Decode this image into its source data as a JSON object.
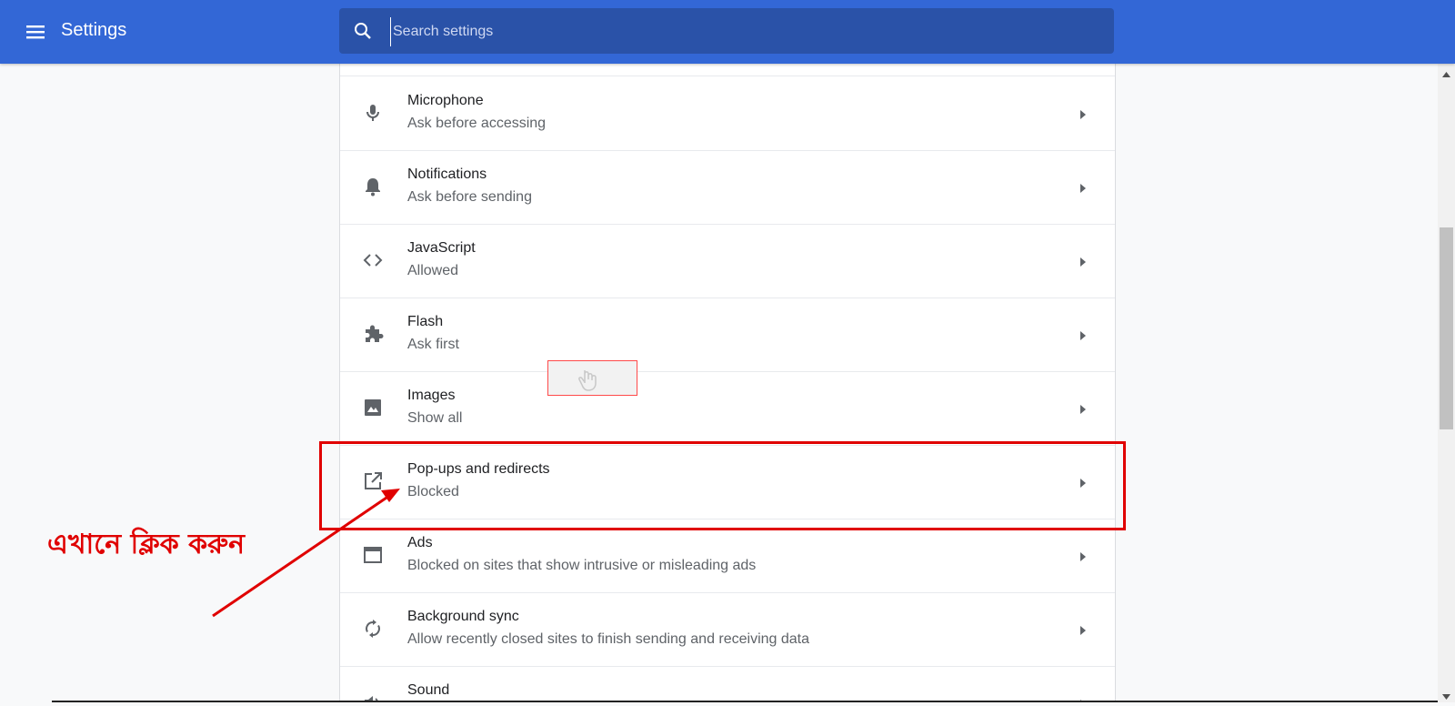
{
  "header": {
    "title": "Settings",
    "menu_icon": "hamburger-menu-icon",
    "search_placeholder": "Search settings",
    "search_icon": "search-icon",
    "background": "#3367d6"
  },
  "settings": {
    "items": [
      {
        "label": "Microphone",
        "sub": "Ask before accessing",
        "icon": "microphone-icon"
      },
      {
        "label": "Notifications",
        "sub": "Ask before sending",
        "icon": "bell-icon"
      },
      {
        "label": "JavaScript",
        "sub": "Allowed",
        "icon": "code-icon"
      },
      {
        "label": "Flash",
        "sub": "Ask first",
        "icon": "puzzle-icon"
      },
      {
        "label": "Images",
        "sub": "Show all",
        "icon": "image-icon"
      },
      {
        "label": "Pop-ups and redirects",
        "sub": "Blocked",
        "icon": "open-in-new-icon"
      },
      {
        "label": "Ads",
        "sub": "Blocked on sites that show intrusive or misleading ads",
        "icon": "ads-window-icon"
      },
      {
        "label": "Background sync",
        "sub": "Allow recently closed sites to finish sending and receiving data",
        "icon": "sync-icon"
      },
      {
        "label": "Sound",
        "sub": "",
        "icon": "sound-icon"
      }
    ]
  },
  "annotation": {
    "text": "এখানে ক্লিক করুন",
    "color": "#e00000"
  }
}
